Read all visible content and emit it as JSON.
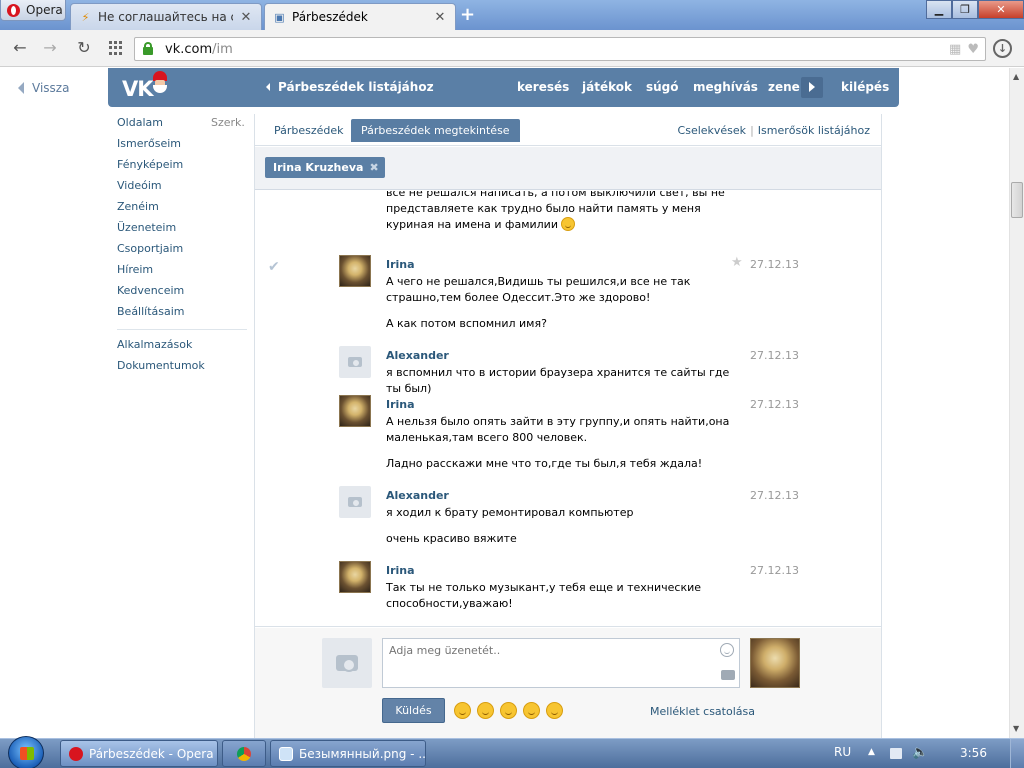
{
  "browser": {
    "app_button_label": "Opera",
    "tabs": [
      {
        "label": "Не соглашайтесь на секс",
        "active": false
      },
      {
        "label": "Párbeszédek",
        "active": true
      }
    ],
    "url_domain": "vk.com",
    "url_path": "/im",
    "window_controls": {
      "minimize_icon": "minimize-icon",
      "maximize_icon": "maximize-icon",
      "close_icon": "close-icon"
    }
  },
  "page": {
    "back_label": "Vissza",
    "header": {
      "logo_text": "VK",
      "back_to_list": "Párbeszédek listájához",
      "links": [
        "keresés",
        "játékok",
        "súgó",
        "meghívás",
        "zene",
        "kilépés"
      ]
    },
    "left_nav": {
      "items": [
        "Oldalam",
        "Ismerőseim",
        "Fényképeim",
        "Videóim",
        "Zenéim",
        "Üzeneteim",
        "Csoportjaim",
        "Híreim",
        "Kedvenceim",
        "Beállításaim"
      ],
      "edit_label": "Szerk.",
      "extra_items": [
        "Alkalmazások",
        "Dokumentumok"
      ]
    },
    "tabs": {
      "dialogs": "Párbeszédek",
      "view_dialog": "Párbeszédek megtekintése",
      "actions": "Cselekvések",
      "separator": "|",
      "to_friends": "Ismerősök listájához"
    },
    "peer_chip": "Irina Kruzheva",
    "messages": [
      {
        "name": "",
        "date": "",
        "avatar": "none",
        "text": [
          "всё не решался написать, а потом выключили свет, вы не представляете как трудно было найти память у меня куриная на имена и фамилии"
        ],
        "smile": true
      },
      {
        "name": "Irina",
        "date": "27.12.13",
        "avatar": "photo",
        "text": [
          "А чего не решался,Видишь ты решился,и все не так страшно,тем более Одессит.Это же здорово!",
          "А как потом вспомнил имя?"
        ]
      },
      {
        "name": "Alexander",
        "date": "27.12.13",
        "avatar": "camera",
        "text": [
          "я вспомнил что в истории браузера хранится те сайты где ты был)"
        ]
      },
      {
        "name": "Irina",
        "date": "27.12.13",
        "avatar": "photo",
        "text": [
          "А нельзя было опять зайти в эту группу,и опять найти,она маленькая,там всего 800 человек.",
          "Ладно расскажи мне что то,где ты был,я тебя ждала!"
        ]
      },
      {
        "name": "Alexander",
        "date": "27.12.13",
        "avatar": "camera",
        "text": [
          "я ходил к брату ремонтировал компьютер",
          "очень красиво вяжите"
        ]
      },
      {
        "name": "Irina",
        "date": "27.12.13",
        "avatar": "photo",
        "text": [
          "Так ты не только музыкант,у тебя еще и технические способности,уважаю!"
        ]
      }
    ],
    "composer": {
      "placeholder": "Adja meg üzenetét..",
      "send_label": "Küldés",
      "attach_label": "Melléklet csatolása"
    }
  },
  "taskbar": {
    "tasks": [
      {
        "label": "Párbeszédek - Opera",
        "active": true
      },
      {
        "label": "",
        "active": false
      },
      {
        "label": "Безымянный.png - ...",
        "active": false
      }
    ],
    "lang": "RU",
    "clock": "3:56"
  },
  "colors": {
    "vk_blue": "#5a7fa6",
    "link": "#2b587a",
    "accent_button": "#6383a8"
  }
}
